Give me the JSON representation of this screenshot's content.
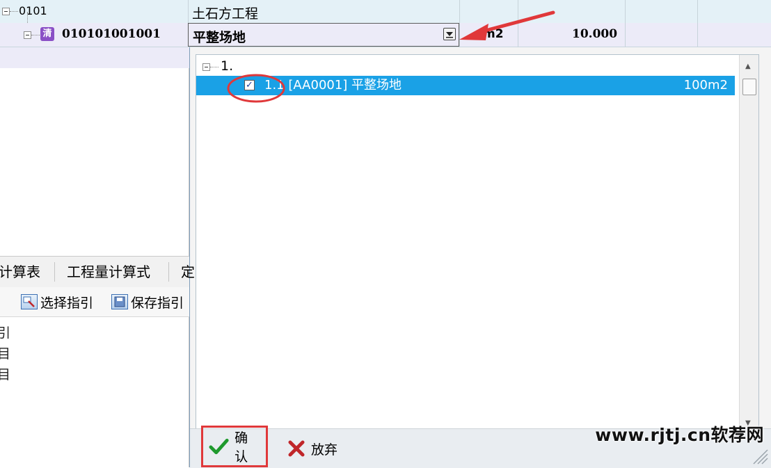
{
  "grid": {
    "row1": {
      "code": "0101",
      "name": "土石方工程"
    },
    "row2": {
      "code": "010101001001",
      "badge": "清",
      "name": "平整场地",
      "unit_partial": "m2",
      "quantity": "10.000"
    }
  },
  "popup": {
    "group_label": "1.",
    "items": [
      {
        "label": "1.1 [AA0001] 平整场地",
        "unit": "100m2",
        "checked": true
      }
    ],
    "confirm_label": "确认",
    "cancel_label": "放弃"
  },
  "bottom_panel": {
    "tabs": [
      "计算表",
      "工程量计算式",
      "定"
    ],
    "toolbar": {
      "select_guide": "选择指引",
      "save_guide": "保存指引"
    },
    "list_fragments": [
      "引",
      "目",
      "目"
    ]
  },
  "watermark": "www.rjtj.cn软荐网",
  "colors": {
    "selection": "#1aa1e6",
    "annotation_red": "#e0383a",
    "badge_purple": "#8a4fc6"
  }
}
